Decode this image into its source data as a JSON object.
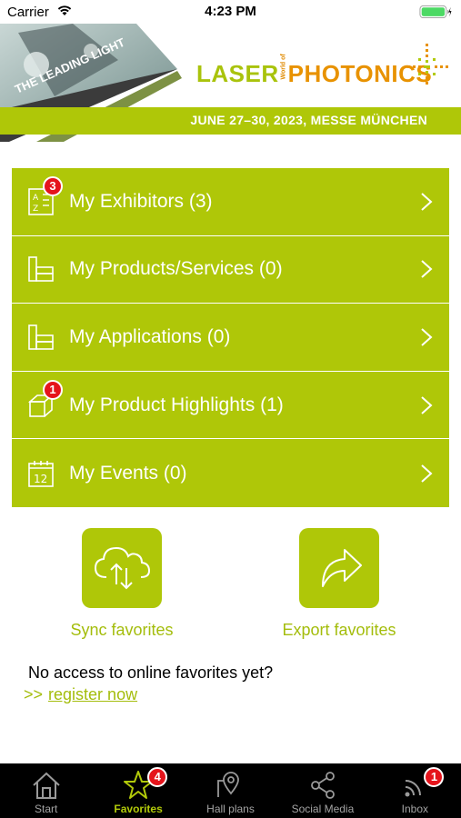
{
  "status_bar": {
    "carrier": "Carrier",
    "time": "4:23 PM"
  },
  "banner": {
    "slogan": "THE LEADING LIGHT",
    "logo_laser": "LASER",
    "logo_world_of": "World of",
    "logo_photonics": "PHOTONICS",
    "date_text": "JUNE 27–30, 2023, MESSE MÜNCHEN"
  },
  "menu": {
    "items": [
      {
        "label": "My Exhibitors (3)",
        "icon": "a-z-list-icon",
        "badge": "3"
      },
      {
        "label": "My Products/Services (0)",
        "icon": "products-icon",
        "badge": ""
      },
      {
        "label": "My Applications (0)",
        "icon": "applications-icon",
        "badge": ""
      },
      {
        "label": "My Product Highlights (1)",
        "icon": "box-icon",
        "badge": "1"
      },
      {
        "label": "My Events (0)",
        "icon": "calendar-icon",
        "badge": ""
      }
    ]
  },
  "actions": {
    "sync_label": "Sync favorites",
    "export_label": "Export favorites"
  },
  "online": {
    "message": "No access to online favorites yet?",
    "arrow": ">>",
    "register_link": "register now"
  },
  "tabbar": {
    "tabs": [
      {
        "label": "Start",
        "icon": "home-icon",
        "badge": ""
      },
      {
        "label": "Favorites",
        "icon": "star-icon",
        "badge": "4"
      },
      {
        "label": "Hall plans",
        "icon": "map-pin-icon",
        "badge": ""
      },
      {
        "label": "Social Media",
        "icon": "share-icon",
        "badge": ""
      },
      {
        "label": "Inbox",
        "icon": "inbox-icon",
        "badge": "1"
      }
    ],
    "active": "Favorites"
  },
  "colors": {
    "accent": "#afc708",
    "badge": "#e5141c",
    "tabbar_bg": "#000000",
    "logo_orange": "#e89200"
  }
}
